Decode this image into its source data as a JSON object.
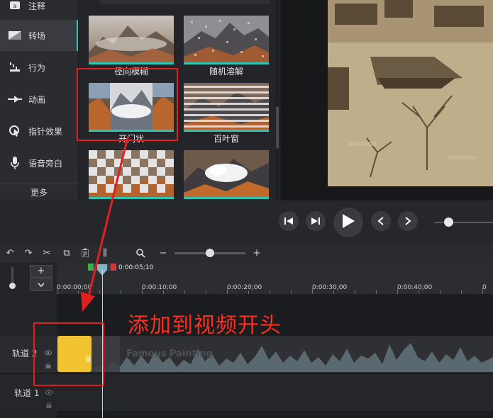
{
  "sidebar": {
    "items": [
      {
        "label": "注释",
        "icon": "annotation-icon"
      },
      {
        "label": "转场",
        "icon": "transition-icon"
      },
      {
        "label": "行为",
        "icon": "behavior-icon"
      },
      {
        "label": "动画",
        "icon": "animation-icon"
      },
      {
        "label": "指针效果",
        "icon": "cursor-effect-icon"
      },
      {
        "label": "语音旁白",
        "icon": "microphone-icon"
      }
    ],
    "active": "转场",
    "more_label": "更多"
  },
  "transitions": {
    "items": [
      {
        "label": "径向模糊"
      },
      {
        "label": "随机溶解"
      },
      {
        "label": "开门状"
      },
      {
        "label": "百叶窗"
      },
      {
        "label": ""
      },
      {
        "label": ""
      }
    ],
    "highlighted": "开门状"
  },
  "timeline": {
    "playhead_time": "0:00:05;10",
    "ruler_labels": [
      "0:00:00;00",
      "0:00:10;00",
      "0:00:20;00",
      "0:00:30;00",
      "0:00:40;00"
    ],
    "tracks": [
      {
        "name": "轨道 2",
        "clip_title": "Famous Painting"
      },
      {
        "name": "轨道 1"
      }
    ]
  },
  "annotation": {
    "text": "添加到视频开头",
    "color": "#ff2d1f"
  },
  "colors": {
    "accent": "#2ec4b6",
    "clip_yellow": "#f1c232"
  }
}
